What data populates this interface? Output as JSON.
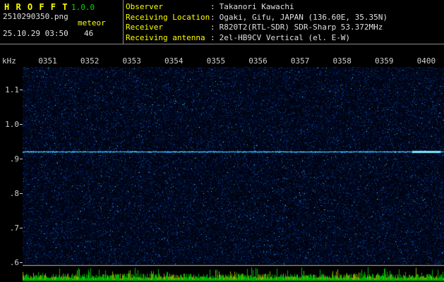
{
  "header": {
    "app_title": "H R O F F T",
    "version": "1.0.0",
    "filename": "2510290350.png",
    "mode": "meteor",
    "datetime": "25.10.29 03:50",
    "count": "46",
    "info": [
      {
        "label": "Observer",
        "sep": ":",
        "value": "Takanori Kawachi"
      },
      {
        "label": "Receiving Location",
        "sep": ":",
        "value": "Ogaki, Gifu, JAPAN (136.60E, 35.35N)"
      },
      {
        "label": "Receiver",
        "sep": ":",
        "value": "R820T2(RTL-SDR) SDR-Sharp 53.372MHz"
      },
      {
        "label": "Receiving antenna",
        "sep": ":",
        "value": "2el-HB9CV Vertical (el. E-W)"
      }
    ]
  },
  "chart_data": {
    "type": "heatmap",
    "ylabel": "kHz",
    "x_ticks": [
      "0351",
      "0352",
      "0353",
      "0354",
      "0355",
      "0356",
      "0357",
      "0358",
      "0359",
      "0400"
    ],
    "y_ticks": [
      "1.1",
      "1.0",
      ".9",
      ".8",
      ".7",
      ".6"
    ],
    "y_tick_values": [
      1.1,
      1.0,
      0.9,
      0.8,
      0.7,
      0.6
    ],
    "ylim": [
      0.58,
      1.17
    ],
    "grid": false,
    "legend": false,
    "carrier_line_khz": 0.92,
    "description": "Dark blue random-noise spectrogram with a continuous cyan carrier line near 0.92 kHz (brighter segment near the right edge) and a green signal-level bar strip along the bottom below a gray separator line",
    "colors": {
      "background": "#000010",
      "carrier": "#50d8ff",
      "noise_speckle": "#1030a0",
      "meter": "#00b400",
      "meter_alt": "#93a800",
      "separator": "#b8bcbc"
    }
  }
}
